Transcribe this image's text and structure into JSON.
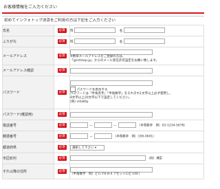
{
  "section_title": "お客様情報をご入力ください",
  "intro": "初めてインフォトップ決済をご利用の方は下記をご入力ください",
  "required_label": "必須",
  "rows": {
    "name": {
      "label": "氏名",
      "last": "姓",
      "first": "名"
    },
    "furigana": {
      "label": "ふりがな",
      "last": "姓",
      "first": "名"
    },
    "email": {
      "label": "メールアドレス",
      "hint1": "※携帯メールアドレスをご登録の方は、",
      "hint2": "「@infotop.jp」からのメール受信許可設定をお願い致します。"
    },
    "email_confirm": {
      "label": "メールアドレス確認"
    },
    "password": {
      "label": "パスワード",
      "show_label": "パスワードを表示する",
      "hint1": "パスワードは「半角英字」「半角数字」をそれぞれ1文字以上必ず使用し、",
      "hint2": "8文字以上20文字以下で設定してください。",
      "hint3": "(例) info80p"
    },
    "password_confirm": {
      "label": "パスワード(確認用)"
    },
    "phone": {
      "label": "電話番号",
      "dash": "－",
      "hint": "（半角数字　例）03-1234-5678）"
    },
    "zip": {
      "label": "郵便番号",
      "dash": "－",
      "hint": "（半角数字　例）106-0041）"
    },
    "prefecture": {
      "label": "都道府県",
      "selected": "選択して下さい"
    },
    "city": {
      "label": "市区町村",
      "hint": "（例）港区"
    },
    "address": {
      "label": "それ以降の住所",
      "hint1": "（半角数字　例）ビルマ6-8-4 アセッシロビル6F）",
      "hint2": "※番地やマンション名などの入力"
    }
  }
}
